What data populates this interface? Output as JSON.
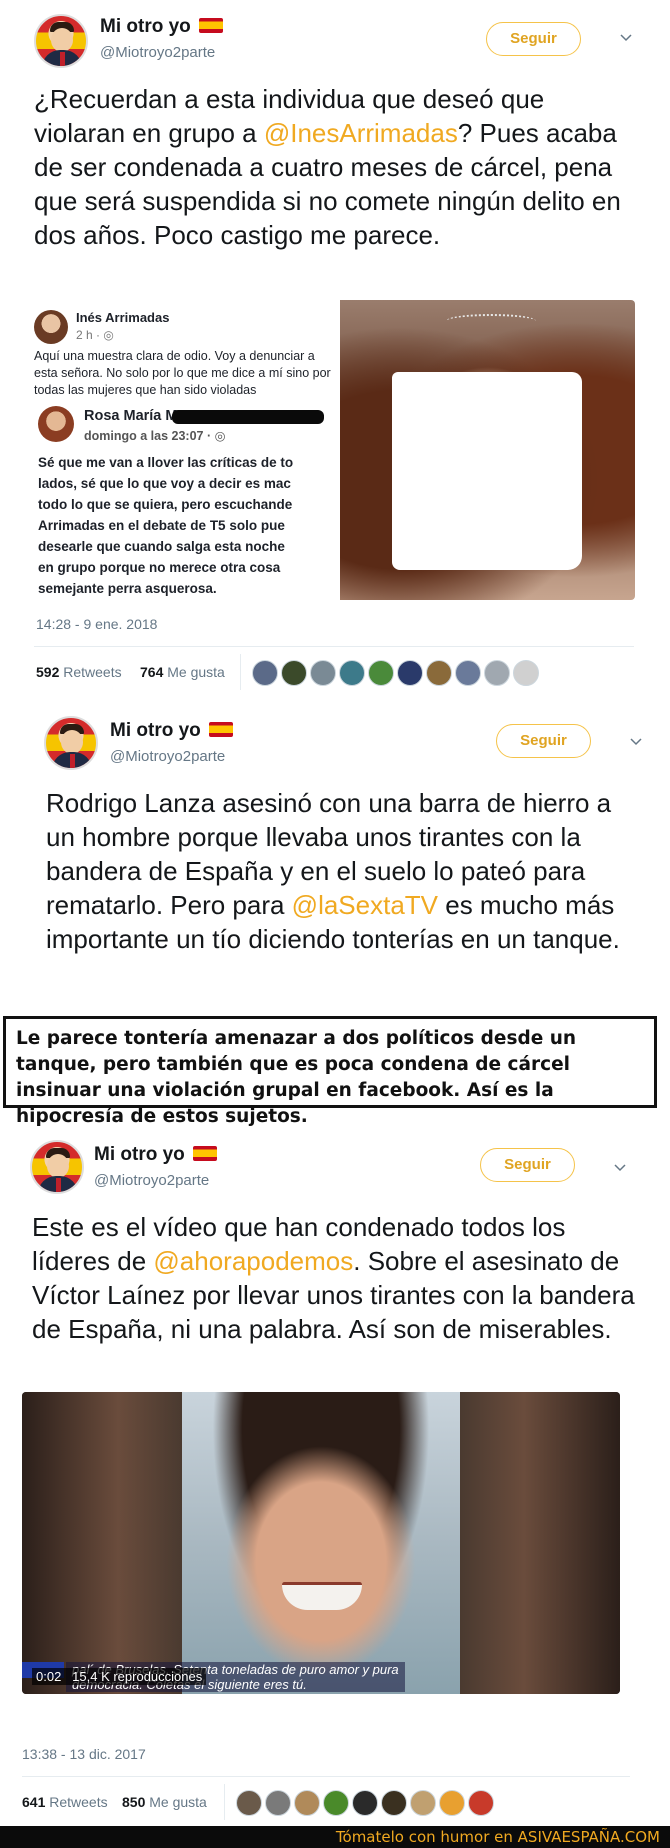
{
  "tweet1": {
    "name": "Mi otro yo",
    "handle": "@Miotroyo2parte",
    "follow_label": "Seguir",
    "text_before": "¿Recuerdan a esta individua que deseó que violaran en grupo a ",
    "mention": "@InesArrimadas",
    "text_after": "? Pues acaba de ser condenada a cuatro meses de cárcel, pena que será suspendida si no comete ningún delito en dos años. Poco castigo me parece.",
    "embed": {
      "ines_name": "Inés Arrimadas",
      "ines_time": "2 h · ",
      "ines_text": "Aquí una muestra clara de odio. Voy a denunciar a esta señora. No solo por lo que me dice a mí sino por todas las mujeres que han sido violadas",
      "rosa_name": "Rosa María M",
      "rosa_time": "domingo a las 23:07 · ",
      "rosa_lines": [
        "Sé que me van a llover las críticas de to",
        "lados, sé que lo que voy a decir es mac",
        "todo lo que se quiera, pero escuchande",
        "Arrimadas en el debate de T5 solo pue",
        "desearle que cuando salga esta noche",
        "en grupo porque no merece otra cosa",
        "semejante perra asquerosa."
      ]
    },
    "timestamp": "14:28 - 9 ene. 2018",
    "retweets_count": "592",
    "retweets_label": "Retweets",
    "likes_count": "764",
    "likes_label": "Me gusta"
  },
  "tweet2": {
    "name": "Mi otro yo",
    "handle": "@Miotroyo2parte",
    "follow_label": "Seguir",
    "text_before": "Rodrigo Lanza asesinó con una barra de hierro a un hombre porque llevaba unos tirantes con la bandera de España y en el suelo lo pateó para rematarlo. Pero para ",
    "mention": "@laSextaTV",
    "text_after": " es mucho más importante un tío diciendo tonterías en un tanque."
  },
  "banner": {
    "text": "Le parece tontería amenazar a dos políticos desde un tanque, pero también que es poca condena de cárcel insinuar una violación grupal en facebook. Así es la hipocresía de estos sujetos."
  },
  "tweet3": {
    "name": "Mi otro yo",
    "handle": "@Miotroyo2parte",
    "follow_label": "Seguir",
    "text_before": "Este es el vídeo que han condenado todos los líderes de ",
    "mention": "@ahorapodemos",
    "text_after": ". Sobre el asesinato de Víctor Laínez por llevar unos tirantes con la bandera de España, ni una palabra. Así son de miserables.",
    "video": {
      "caption_line1": "pal´ de Bruselas. Setenta toneladas de puro amor y pura",
      "caption_line2": "democracia. Coletas el siguiente eres tú.",
      "duration": "0:02",
      "views": "15,4 K reproducciones"
    },
    "timestamp": "13:38 - 13 dic. 2017",
    "retweets_count": "641",
    "retweets_label": "Retweets",
    "likes_count": "850",
    "likes_label": "Me gusta"
  },
  "footer": {
    "prefix": "Tómatelo con humor en ",
    "brand": "ASIVAESPAÑA.COM"
  },
  "colors": {
    "accent": "#f0a921",
    "text": "#14171a",
    "muted": "#657786"
  }
}
